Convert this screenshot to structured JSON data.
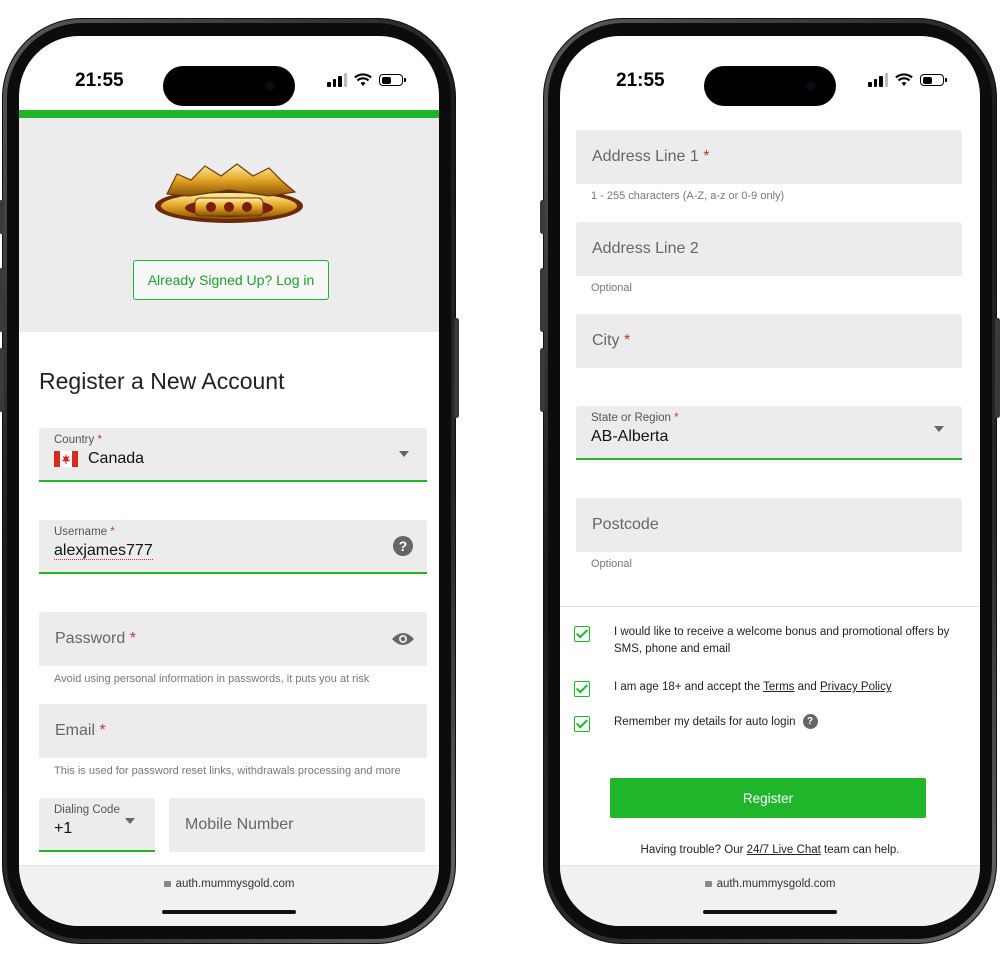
{
  "status_bar": {
    "time": "21:55"
  },
  "left_screen": {
    "login_button": "Already Signed Up? Log in",
    "title": "Register a New Account",
    "country": {
      "label": "Country",
      "value": "Canada",
      "flag": "canada-flag-icon"
    },
    "username": {
      "label": "Username",
      "value": "alexjames777"
    },
    "password": {
      "placeholder": "Password",
      "helper": "Avoid using personal information in passwords, it puts you at risk"
    },
    "email": {
      "placeholder": "Email",
      "helper": "This is used for password reset links, withdrawals processing and more"
    },
    "dialing_code": {
      "label": "Dialing Code",
      "value": "+1"
    },
    "mobile": {
      "placeholder": "Mobile Number"
    },
    "url": "auth.mummysgold.com"
  },
  "right_screen": {
    "address1": {
      "placeholder": "Address Line 1",
      "helper": "1 - 255 characters (A-Z, a-z or 0-9 only)"
    },
    "address2": {
      "placeholder": "Address Line 2",
      "helper": "Optional"
    },
    "city": {
      "placeholder": "City"
    },
    "state": {
      "label": "State or Region",
      "value": "AB-Alberta"
    },
    "postcode": {
      "placeholder": "Postcode",
      "helper": "Optional"
    },
    "checkboxes": {
      "promo": "I would like to receive a welcome bonus and promotional offers by SMS, phone and email",
      "age_prefix": "I am age 18+ and accept the",
      "terms": "Terms",
      "and": "and",
      "privacy": "Privacy Policy",
      "remember": "Remember my details for auto login"
    },
    "register_button": "Register",
    "trouble_prefix": "Having trouble? Our",
    "live_chat": "24/7 Live Chat",
    "trouble_suffix": "team can help.",
    "url": "auth.mummysgold.com"
  },
  "colors": {
    "accent": "#1fb62b",
    "required": "#c0392b",
    "field_bg": "#ececec"
  },
  "icons": [
    "signal-icon",
    "wifi-icon",
    "battery-icon",
    "chevron-down-icon",
    "help-icon",
    "eye-icon",
    "lock-icon",
    "checkbox-checked-icon",
    "mummys-gold-logo"
  ]
}
